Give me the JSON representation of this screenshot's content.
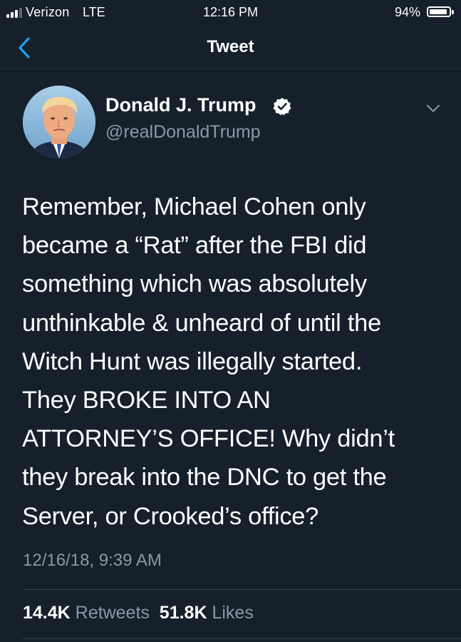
{
  "status_bar": {
    "carrier": "Verizon",
    "network": "LTE",
    "time": "12:16 PM",
    "battery_percent": "94%",
    "battery_level": 0.94,
    "signal_bars": 3
  },
  "nav": {
    "title": "Tweet",
    "back_icon": "chevron-left-icon"
  },
  "tweet": {
    "display_name": "Donald J. Trump",
    "handle": "@realDonaldTrump",
    "verified": true,
    "text_lines": [
      "Remember, Michael Cohen only",
      "became a “Rat” after the FBI did",
      "something which was absolutely",
      "unthinkable & unheard of until the",
      "Witch Hunt was illegally started.",
      "They BROKE INTO AN",
      "ATTORNEY’S OFFICE! Why didn’t",
      "they break into the DNC to get the",
      "Server, or Crooked’s office?"
    ],
    "timestamp": "12/16/18, 9:39 AM",
    "retweets_count": "14.4K",
    "retweets_label": "Retweets",
    "likes_count": "51.8K",
    "likes_label": "Likes"
  },
  "colors": {
    "background": "#15202b",
    "accent": "#1da1f2",
    "secondary_text": "#8899a6",
    "divider": "#38444d"
  }
}
